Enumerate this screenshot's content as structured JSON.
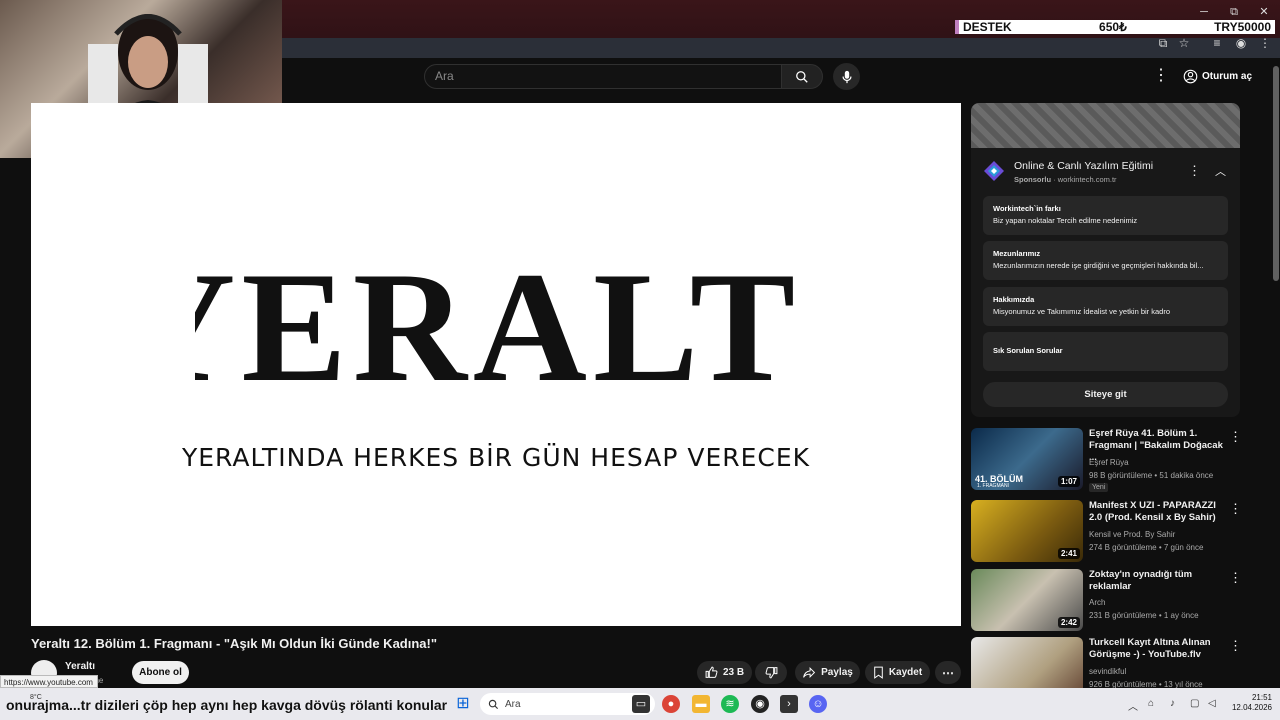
{
  "browser": {
    "minimize": "─",
    "restore": "⧉",
    "close": "✕",
    "colors": {
      "titlebar": "#3a1519"
    }
  },
  "overlay": {
    "donation_label": "DESTEK",
    "donation_current": "650₺",
    "donation_goal": "TRY50000"
  },
  "header": {
    "search_placeholder": "Ara",
    "signin_label": "Oturum aç"
  },
  "video": {
    "logo_text": "YERALTI",
    "tagline": "YERALTINDA HERKES BİR GÜN HESAP VERECEK",
    "title": "Yeraltı 12. Bölüm 1. Fragmanı - \"Aşık Mı Oldun İki Günde Kadına!\"",
    "channel": "Yeraltı",
    "subscribers_partial": "one",
    "subscribe_label": "Abone ol",
    "likes": "23 B",
    "share_label": "Paylaş",
    "save_label": "Kaydet",
    "status_url": "https://www.youtube.com"
  },
  "ad": {
    "title": "Online & Canlı Yazılım Eğitimi",
    "sponsored": "Sponsorlu",
    "domain": "workintech.com.tr",
    "cards": [
      {
        "title": "Workintech`in farkı",
        "desc": "Biz yapan noktalar Tercih edilme nedenimiz"
      },
      {
        "title": "Mezunlarımız",
        "desc": "Mezunlarımızın nerede işe girdiğini ve geçmişleri hakkında bil..."
      },
      {
        "title": "Hakkımızda",
        "desc": "Misyonumuz ve Takımımız İdealist ve yetkin bir kadro"
      },
      {
        "title": "Sık Sorulan Sorular",
        "desc": ""
      }
    ],
    "cta": "Siteye git"
  },
  "recommendations": [
    {
      "title": "Eşref Rüya 41. Bölüm 1. Fragmanı | \"Bakalım Doğacak ...",
      "channel": "Eşref Rüya",
      "meta": "98 B görüntüleme • 51 dakika önce",
      "duration": "1:07",
      "badge": "Yeni",
      "thumb_text": "41. BÖLÜM",
      "thumb_sub": "1. FRAGMANI"
    },
    {
      "title": "Manifest X UZI - PAPARAZZI 2.0 (Prod. Kensil x By Sahir)",
      "channel": "Kensil ve Prod. By Sahir",
      "meta": "274 B görüntüleme • 7 gün önce",
      "duration": "2:41"
    },
    {
      "title": "Zoktay'ın oynadığı tüm reklamlar",
      "channel": "Arch",
      "meta": "231 B görüntüleme • 1 ay önce",
      "duration": "2:42"
    },
    {
      "title": "Turkcell Kayıt Altına Alınan Görüşme -) - YouTube.flv",
      "channel": "sevindikful",
      "meta": "926 B görüntüleme • 13 yıl önce",
      "duration": ""
    }
  ],
  "taskbar": {
    "ticker": "onurajma...tr dizileri çöp hep aynı hep kavga dövüş rölanti konular",
    "weather": "8°C",
    "search_label": "Ara",
    "time": "21:51",
    "date": "12.04.2026"
  }
}
